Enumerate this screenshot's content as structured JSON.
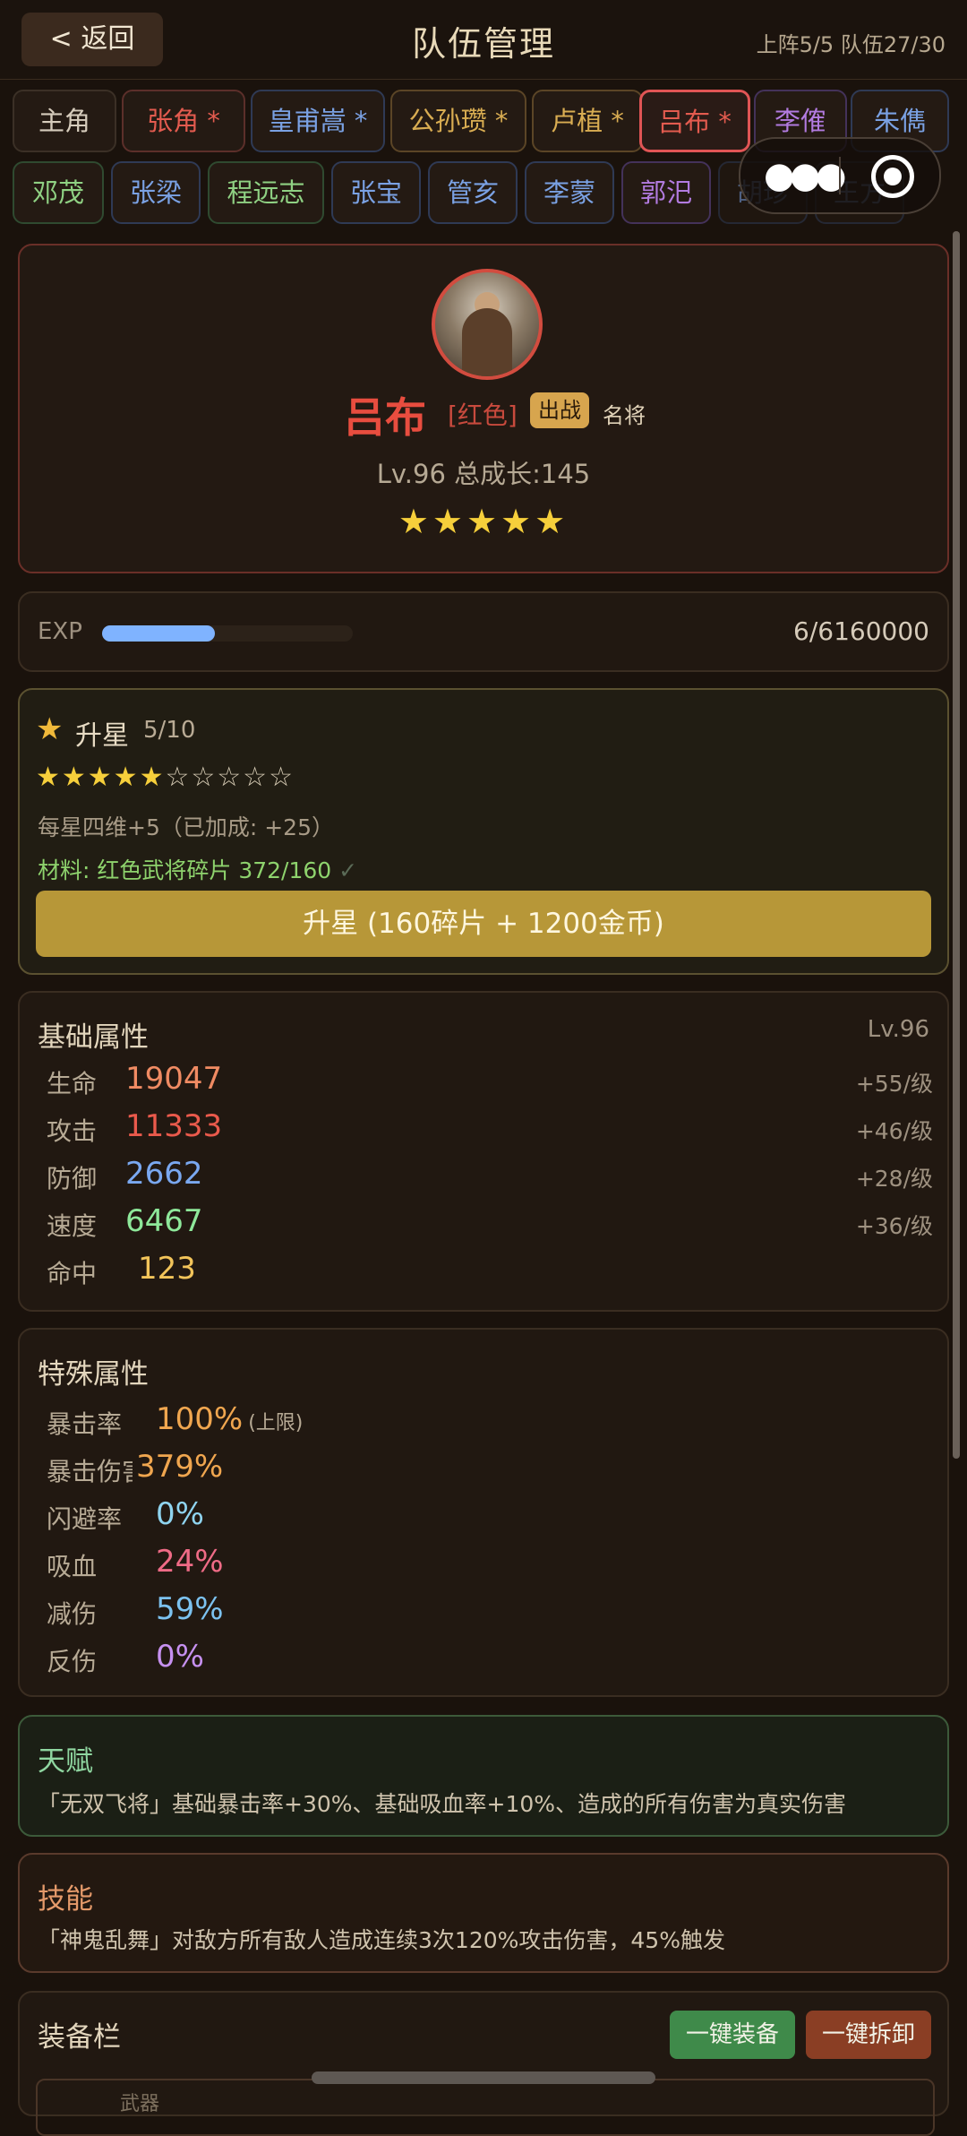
{
  "header": {
    "back_label": "< 返回",
    "title": "队伍管理",
    "meta": "上阵5/5 队伍27/30"
  },
  "tabs_row1": [
    {
      "label": "主角",
      "color": "white"
    },
    {
      "label": "张角 *",
      "color": "red"
    },
    {
      "label": "皇甫嵩 *",
      "color": "blue"
    },
    {
      "label": "公孙瓒 *",
      "color": "gold"
    },
    {
      "label": "卢植 *",
      "color": "gold"
    },
    {
      "label": "吕布 *",
      "color": "red",
      "selected": true
    },
    {
      "label": "李傕",
      "color": "purple"
    },
    {
      "label": "朱儁",
      "color": "blue"
    }
  ],
  "tabs_row2": [
    {
      "label": "邓茂",
      "color": "green"
    },
    {
      "label": "张梁",
      "color": "blue"
    },
    {
      "label": "程远志",
      "color": "green"
    },
    {
      "label": "张宝",
      "color": "blue"
    },
    {
      "label": "管亥",
      "color": "blue"
    },
    {
      "label": "李蒙",
      "color": "blue"
    },
    {
      "label": "郭汜",
      "color": "purple"
    },
    {
      "label": "胡珍",
      "color": "blue"
    },
    {
      "label": "王方",
      "color": "blue"
    }
  ],
  "hero": {
    "name": "吕布",
    "quality": "[红色]",
    "badge": "出战",
    "tag": "名将",
    "level_line": "Lv.96  总成长:145",
    "stars": "★★★★★"
  },
  "exp": {
    "label": "EXP",
    "value": "6/6160000",
    "progress": 0.45
  },
  "star_up": {
    "title": "升星",
    "count": "5/10",
    "filled_stars": "★★★★★",
    "empty_stars": "☆☆☆☆☆",
    "bonus": "每星四维+5（已加成: +25）",
    "material": "材料: 红色武将碎片 372/160",
    "check": "✓",
    "button": "升星 (160碎片 + 1200金币)"
  },
  "base_stats": {
    "title": "基础属性",
    "level": "Lv.96",
    "rows": [
      {
        "label": "生命",
        "value": "19047",
        "growth": "+55/级",
        "color": "#f08b63"
      },
      {
        "label": "攻击",
        "value": "11333",
        "growth": "+46/级",
        "color": "#ea5a4c"
      },
      {
        "label": "防御",
        "value": "2662",
        "growth": "+28/级",
        "color": "#7aa8f0"
      },
      {
        "label": "速度",
        "value": "6467",
        "growth": "+36/级",
        "color": "#8ee89a"
      },
      {
        "label": "命中",
        "value": "123",
        "growth": "",
        "color": "#f2c45a"
      }
    ]
  },
  "special_stats": {
    "title": "特殊属性",
    "rows": [
      {
        "label": "暴击率",
        "value": "100%",
        "note": "(上限)",
        "color": "#f0a64f"
      },
      {
        "label": "暴击伤害",
        "value": "379%",
        "note": "",
        "color": "#f0a64f"
      },
      {
        "label": "闪避率",
        "value": "0%",
        "note": "",
        "color": "#8fd4f0"
      },
      {
        "label": "吸血",
        "value": "24%",
        "note": "",
        "color": "#ef6b86"
      },
      {
        "label": "减伤",
        "value": "59%",
        "note": "",
        "color": "#7cc2f0"
      },
      {
        "label": "反伤",
        "value": "0%",
        "note": "",
        "color": "#c690f0"
      }
    ]
  },
  "talent": {
    "title": "天赋",
    "desc": "「无双飞将」基础暴击率+30%、基础吸血率+10%、造成的所有伤害为真实伤害"
  },
  "skill": {
    "title": "技能",
    "desc": "「神鬼乱舞」对敌方所有敌人造成连续3次120%攻击伤害，45%触发"
  },
  "equip": {
    "title": "装备栏",
    "equip_all": "一键装备",
    "unequip_all": "一键拆卸",
    "slot_label": "武器"
  }
}
